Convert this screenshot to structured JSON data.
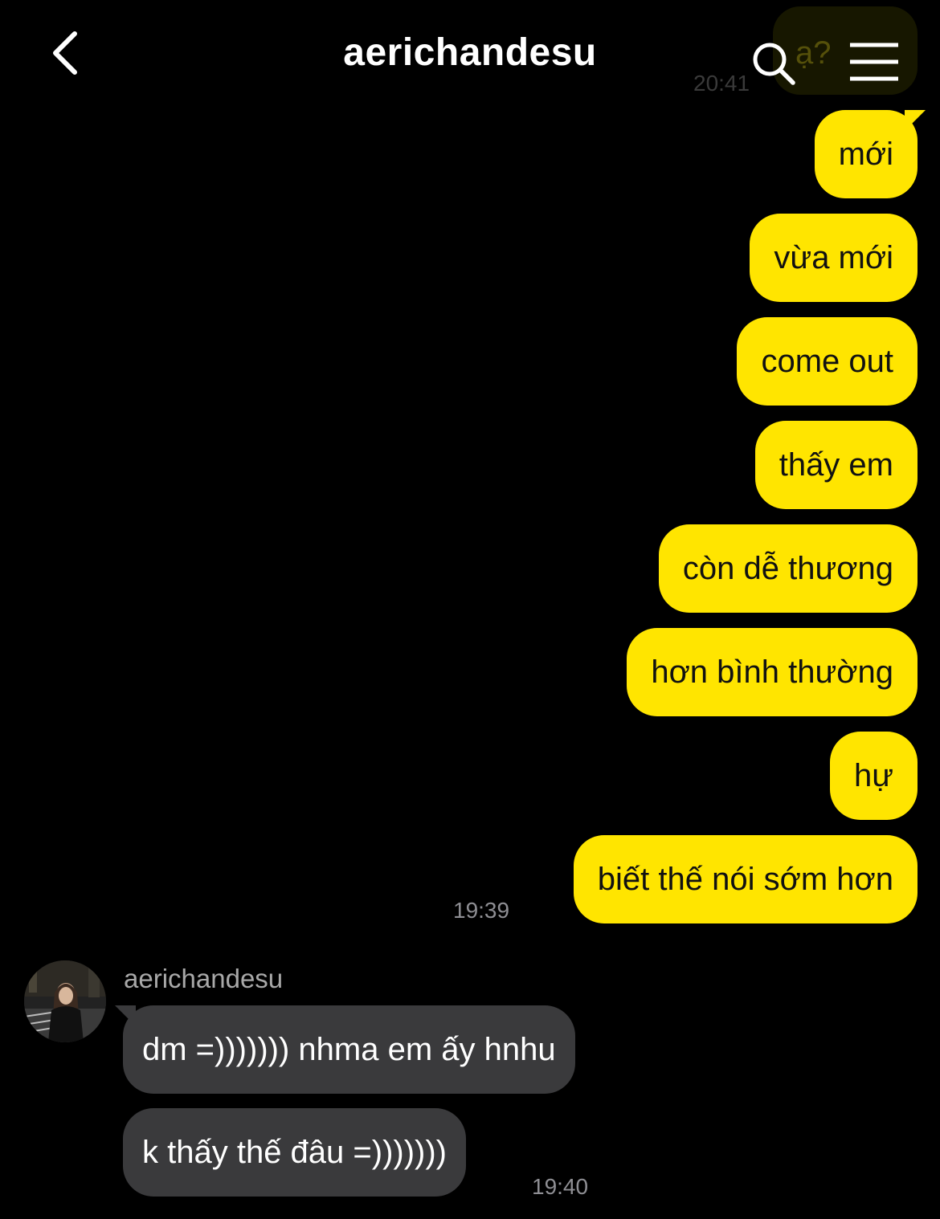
{
  "header": {
    "title": "aerichandesu"
  },
  "peek": {
    "text": "ạ?",
    "time": "20:41"
  },
  "outgoing": [
    "mới",
    "vừa mới",
    "come out",
    "thấy em",
    "còn dễ thương",
    "hơn bình thường",
    "hự",
    "biết thế nói sớm hơn"
  ],
  "outgoing_time": "19:39",
  "incoming": {
    "sender": "aerichandesu",
    "messages": [
      "dm =))))))) nhma em ấy hnhu",
      "k thấy thế đâu =)))))))"
    ],
    "time": "19:40"
  },
  "colors": {
    "outgoing_bubble": "#ffe500",
    "incoming_bubble": "#3a3a3c",
    "background": "#000000",
    "timestamp": "#8e8e93"
  },
  "icons": {
    "back": "chevron-left-icon",
    "search": "search-icon",
    "menu": "hamburger-menu-icon"
  }
}
